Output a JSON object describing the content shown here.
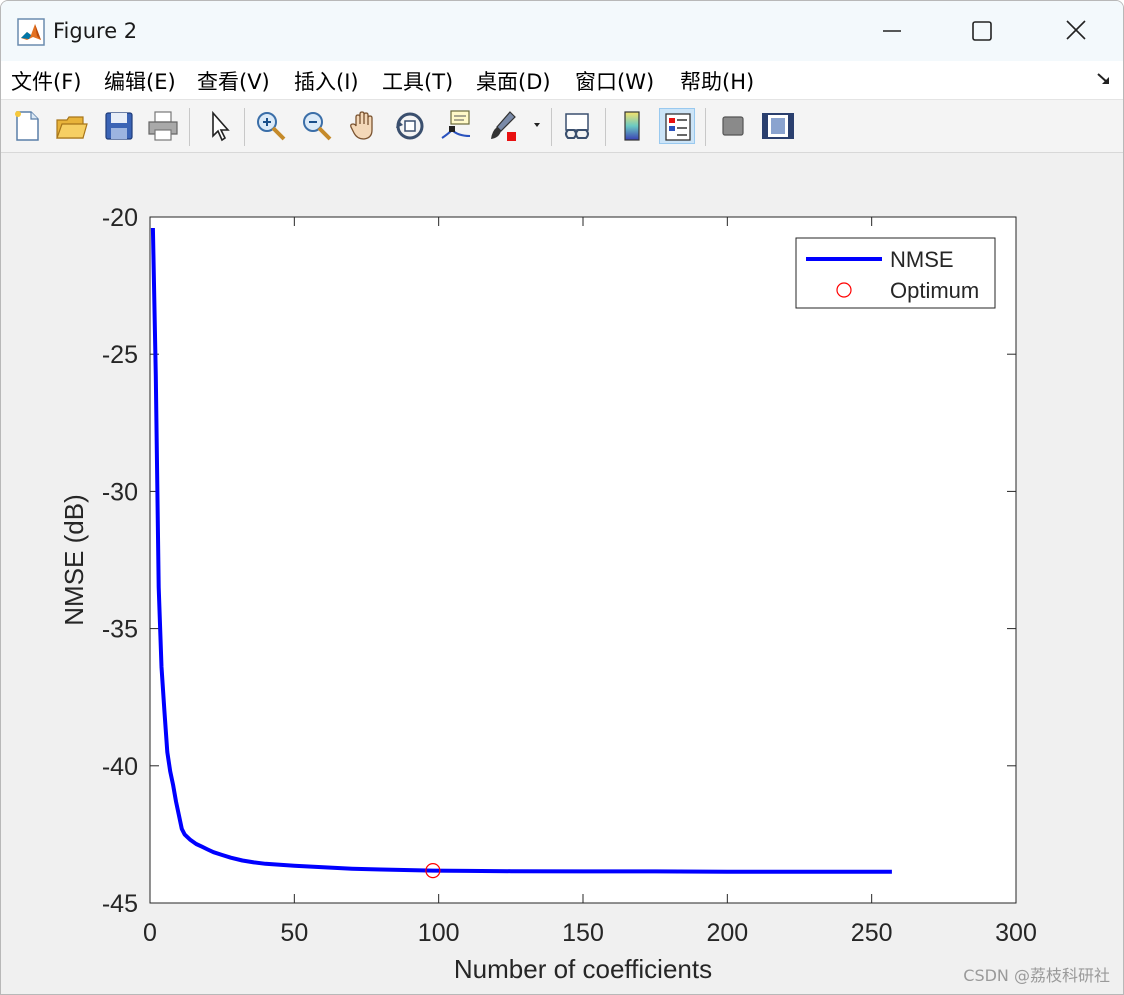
{
  "window": {
    "title": "Figure 2",
    "icon": "matlab-icon"
  },
  "menu": [
    {
      "label": "文件(F)",
      "name": "menu-file"
    },
    {
      "label": "编辑(E)",
      "name": "menu-edit"
    },
    {
      "label": "查看(V)",
      "name": "menu-view"
    },
    {
      "label": "插入(I)",
      "name": "menu-insert"
    },
    {
      "label": "工具(T)",
      "name": "menu-tools"
    },
    {
      "label": "桌面(D)",
      "name": "menu-desktop"
    },
    {
      "label": "窗口(W)",
      "name": "menu-window"
    },
    {
      "label": "帮助(H)",
      "name": "menu-help"
    }
  ],
  "toolbar": [
    "new-figure-icon",
    "open-file-icon",
    "save-icon",
    "print-icon",
    "pointer-icon",
    "zoom-in-icon",
    "zoom-out-icon",
    "pan-icon",
    "rotate-3d-icon",
    "data-cursor-icon",
    "brush-icon",
    "link-plot-icon",
    "colorbar-icon",
    "legend-icon",
    "hide-plot-tools-icon",
    "show-plot-tools-icon"
  ],
  "chart_data": {
    "type": "line",
    "xlabel": "Number of coefficients",
    "ylabel": "NMSE (dB)",
    "xlim": [
      0,
      300
    ],
    "ylim": [
      -45,
      -20
    ],
    "xticks": [
      0,
      50,
      100,
      150,
      200,
      250,
      300
    ],
    "yticks": [
      -20,
      -25,
      -30,
      -35,
      -40,
      -45
    ],
    "grid": false,
    "legend_position": "top-right",
    "series": [
      {
        "name": "NMSE",
        "color": "#0000ff",
        "x": [
          1,
          2,
          3,
          4,
          5,
          6,
          7,
          8,
          9,
          10,
          11,
          12,
          14,
          16,
          18,
          20,
          22,
          25,
          28,
          32,
          36,
          40,
          50,
          60,
          70,
          80,
          90,
          98,
          110,
          125,
          150,
          175,
          200,
          225,
          257
        ],
        "y": [
          -20.4,
          -25.8,
          -33.5,
          -36.4,
          -38.0,
          -39.5,
          -40.2,
          -40.7,
          -41.3,
          -41.8,
          -42.3,
          -42.5,
          -42.7,
          -42.85,
          -42.95,
          -43.05,
          -43.15,
          -43.25,
          -43.35,
          -43.45,
          -43.52,
          -43.57,
          -43.64,
          -43.7,
          -43.75,
          -43.78,
          -43.8,
          -43.82,
          -43.83,
          -43.84,
          -43.85,
          -43.85,
          -43.86,
          -43.86,
          -43.86
        ]
      }
    ],
    "markers": [
      {
        "name": "Optimum",
        "color": "#ff0000",
        "shape": "circle",
        "x": 98,
        "y": -43.82
      }
    ]
  },
  "watermark": "CSDN @荔枝科研社"
}
